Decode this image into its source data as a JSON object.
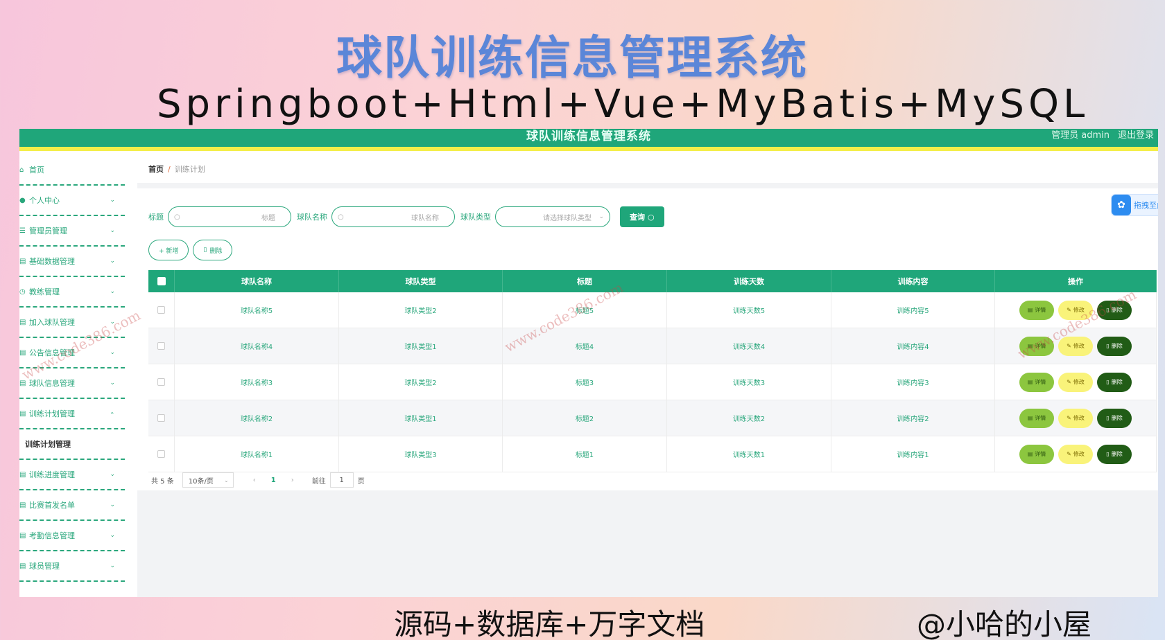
{
  "banner": {
    "title": "球队训练信息管理系统",
    "subtitle": "Springboot+Html+Vue+MyBatis+MySQL",
    "footer_left": "源码+数据库+万字文档",
    "footer_right": "@小哈的小屋"
  },
  "header": {
    "title": "球队训练信息管理系统",
    "user": "管理员 admin",
    "logout": "退出登录"
  },
  "sidebar": {
    "items": [
      {
        "label": "首页",
        "icon": "home-icon"
      },
      {
        "label": "个人中心",
        "icon": "user-icon"
      },
      {
        "label": "管理员管理",
        "icon": "list-icon"
      },
      {
        "label": "基础数据管理",
        "icon": "doc-icon"
      },
      {
        "label": "教练管理",
        "icon": "clock-icon"
      },
      {
        "label": "加入球队管理",
        "icon": "doc-icon"
      },
      {
        "label": "公告信息管理",
        "icon": "doc-icon"
      },
      {
        "label": "球队信息管理",
        "icon": "doc-icon"
      },
      {
        "label": "训练计划管理",
        "icon": "doc-icon"
      },
      {
        "label": "训练计划管理",
        "icon": ""
      },
      {
        "label": "训练进度管理",
        "icon": "doc-icon"
      },
      {
        "label": "比赛首发名单",
        "icon": "doc-icon"
      },
      {
        "label": "考勤信息管理",
        "icon": "doc-icon"
      },
      {
        "label": "球员管理",
        "icon": "doc-icon"
      }
    ]
  },
  "breadcrumb": {
    "home": "首页",
    "separator": "/",
    "current": "训练计划"
  },
  "drag_button": {
    "label": "拖拽至此"
  },
  "search": {
    "title_label": "标题",
    "title_placeholder": "标题",
    "team_name_label": "球队名称",
    "team_name_placeholder": "球队名称",
    "team_type_label": "球队类型",
    "team_type_placeholder": "请选择球队类型",
    "query_button": "查询"
  },
  "actions": {
    "add": "+ 新增",
    "delete": "删除"
  },
  "table": {
    "columns": [
      "球队名称",
      "球队类型",
      "标题",
      "训练天数",
      "训练内容",
      "操作"
    ],
    "rows": [
      {
        "name": "球队名称5",
        "type": "球队类型2",
        "title": "标题5",
        "days": "训练天数5",
        "content": "训练内容5"
      },
      {
        "name": "球队名称4",
        "type": "球队类型1",
        "title": "标题4",
        "days": "训练天数4",
        "content": "训练内容4"
      },
      {
        "name": "球队名称3",
        "type": "球队类型2",
        "title": "标题3",
        "days": "训练天数3",
        "content": "训练内容3"
      },
      {
        "name": "球队名称2",
        "type": "球队类型1",
        "title": "标题2",
        "days": "训练天数2",
        "content": "训练内容2"
      },
      {
        "name": "球队名称1",
        "type": "球队类型3",
        "title": "标题1",
        "days": "训练天数1",
        "content": "训练内容1"
      }
    ],
    "op_detail": "详情",
    "op_edit": "修改",
    "op_delete": "删除"
  },
  "pagination": {
    "total": "共 5 条",
    "page_size": "10条/页",
    "current_page": "1",
    "goto_label": "前往",
    "goto_value": "1",
    "page_suffix": "页"
  },
  "watermark": "www.code386.com",
  "colors": {
    "primary": "#1fa67a",
    "accent_yellow": "#f4ee4a",
    "detail": "#8cc63f",
    "edit": "#f9f37a",
    "delete": "#215c16"
  }
}
